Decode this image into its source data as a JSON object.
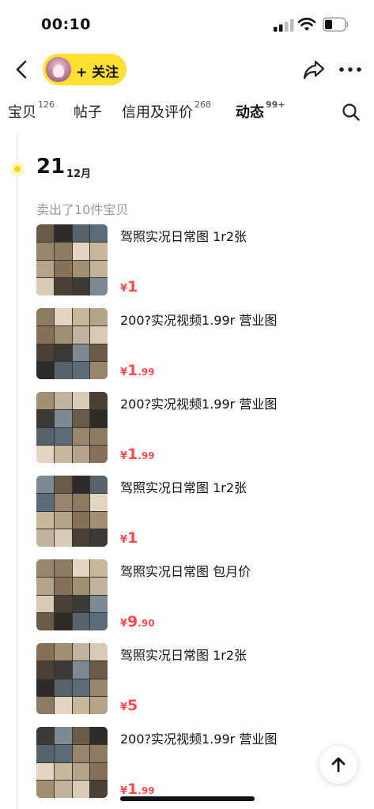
{
  "status_bar": {
    "time": "00:10"
  },
  "header": {
    "follow_label": "+ 关注"
  },
  "tabs": [
    {
      "label": "宝贝",
      "count": "126"
    },
    {
      "label": "帖子",
      "count": ""
    },
    {
      "label": "信用及评价",
      "count": "268"
    },
    {
      "label": "动态",
      "count": "99+"
    }
  ],
  "feed": {
    "date_day": "21",
    "date_month": "12月",
    "sold_note": "卖出了10件宝贝",
    "items": [
      {
        "title": "驾照实况日常图 1r2张",
        "currency": "¥",
        "price_int": "1",
        "price_dec": ""
      },
      {
        "title": "200?实况视频1.99r 营业图",
        "currency": "¥",
        "price_int": "1",
        "price_dec": ".99"
      },
      {
        "title": "200?实况视频1.99r 营业图",
        "currency": "¥",
        "price_int": "1",
        "price_dec": ".99"
      },
      {
        "title": "驾照实况日常图 1r2张",
        "currency": "¥",
        "price_int": "1",
        "price_dec": ""
      },
      {
        "title": "驾照实况日常图 包月价",
        "currency": "¥",
        "price_int": "9",
        "price_dec": ".90"
      },
      {
        "title": "驾照实况日常图 1r2张",
        "currency": "¥",
        "price_int": "5",
        "price_dec": ""
      },
      {
        "title": "200?实况视频1.99r 营业图",
        "currency": "¥",
        "price_int": "1",
        "price_dec": ".99"
      }
    ]
  },
  "colors": {
    "accent_yellow": "#ffe033",
    "price_red": "#ff4d4f"
  },
  "icons": [
    "back-arrow-icon",
    "share-icon",
    "more-icon",
    "search-icon",
    "scroll-top-icon"
  ]
}
